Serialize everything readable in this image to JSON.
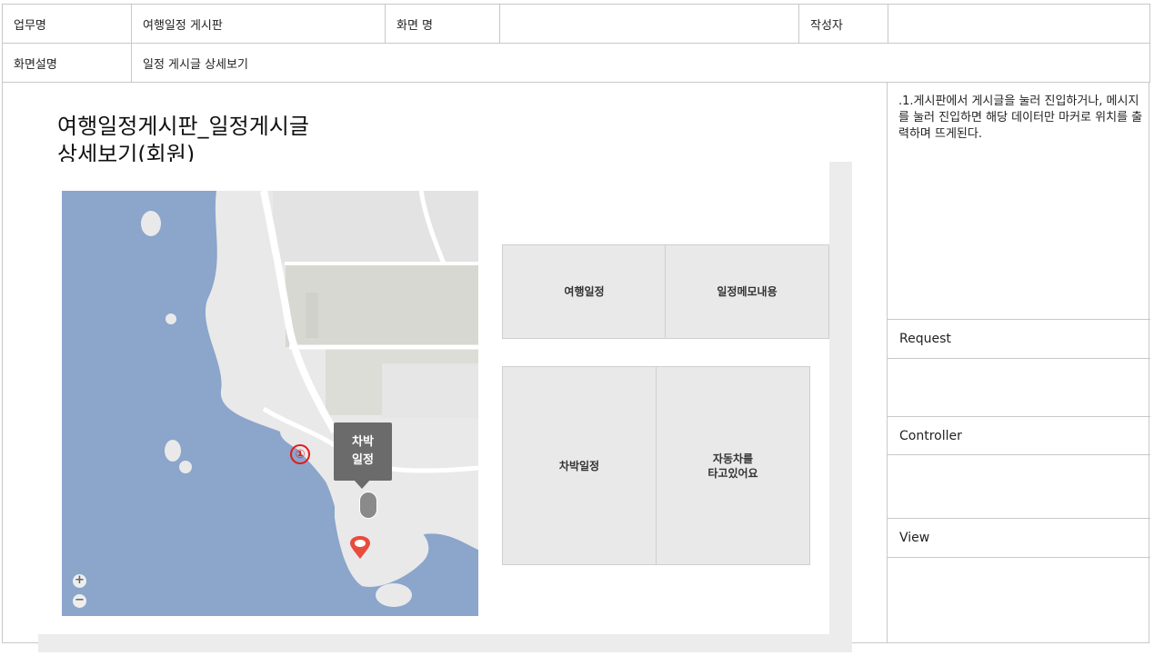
{
  "header": {
    "task_label": "업무명",
    "task_value": "여행일정 게시판",
    "screen_label": "화면 명",
    "screen_value": "",
    "author_label": "작성자",
    "author_value": "",
    "desc_label": "화면설명",
    "desc_value": "일정 게시글 상세보기"
  },
  "main": {
    "title_line1": "여행일정게시판_일정게시글",
    "title_line2": "상세보기(회원)"
  },
  "map": {
    "tooltip_line1": "차박",
    "tooltip_line2": "일정",
    "marker_number": "①",
    "zoom_in": "+",
    "zoom_out": "−"
  },
  "info_table": {
    "col1": "여행일정",
    "col2": "일정메모내용"
  },
  "detail_table": {
    "col1": "차박일정",
    "col2_line1": "자동차를",
    "col2_line2": "타고있어요"
  },
  "side": {
    "description": ".1.게시판에서 게시글을 눌러 진입하거나, 메시지를 눌러 진입하면 해당 데이터만 마커로 위치를 출력하며 뜨게된다.",
    "request_label": "Request",
    "controller_label": "Controller",
    "view_label": "View"
  },
  "colors": {
    "sea": "#8ba5cb",
    "land": "#e9e9e9",
    "marker": "#e84c3d",
    "tooltip": "#6b6b6b"
  }
}
